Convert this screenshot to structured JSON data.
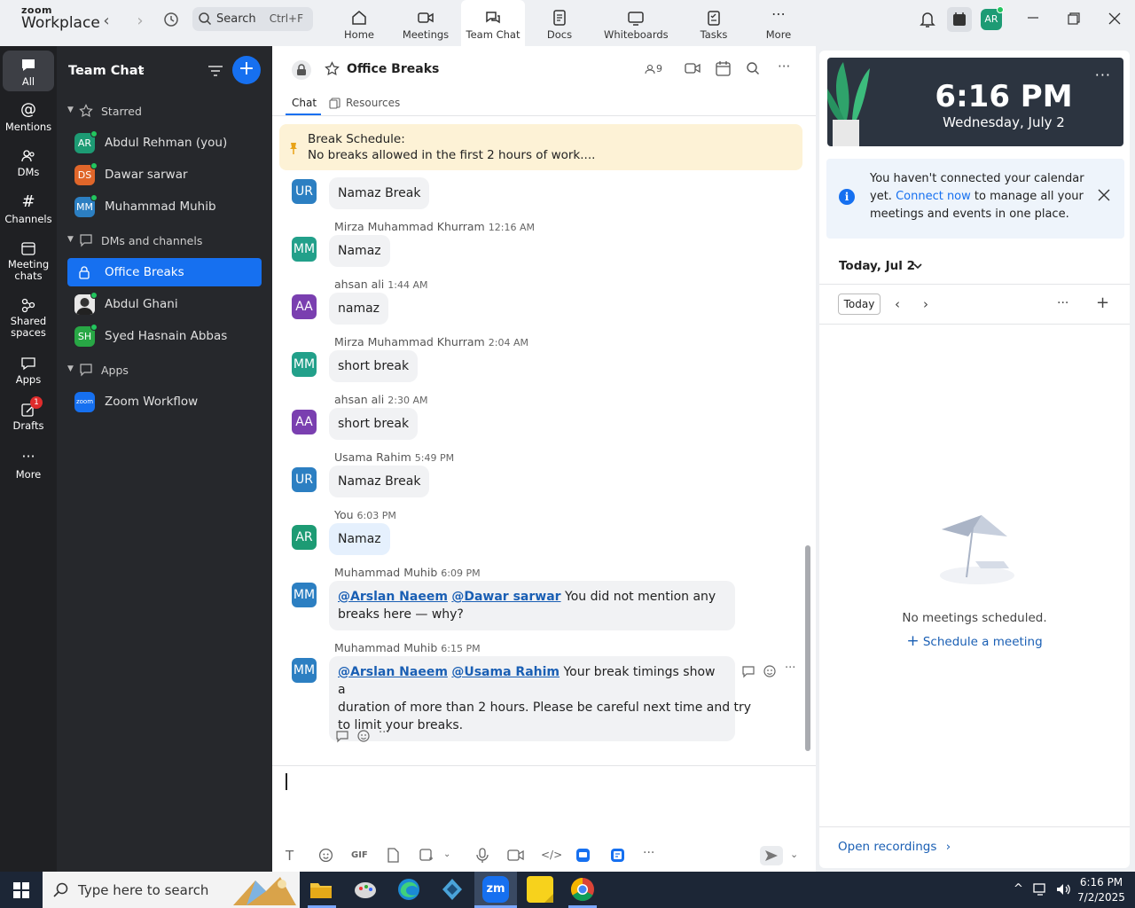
{
  "app": {
    "logo_small": "zoom",
    "logo_big": "Workplace",
    "search_label": "Search",
    "search_shortcut": "Ctrl+F",
    "nav": [
      {
        "label": "Home"
      },
      {
        "label": "Meetings"
      },
      {
        "label": "Team Chat"
      },
      {
        "label": "Docs"
      },
      {
        "label": "Whiteboards"
      },
      {
        "label": "Tasks"
      },
      {
        "label": "More"
      }
    ],
    "user_initials": "AR"
  },
  "rail": [
    {
      "label": "All"
    },
    {
      "label": "Mentions"
    },
    {
      "label": "DMs"
    },
    {
      "label": "Channels"
    },
    {
      "label": "Meeting chats"
    },
    {
      "label": "Shared spaces"
    },
    {
      "label": "Apps"
    },
    {
      "label": "Drafts"
    },
    {
      "label": "More"
    }
  ],
  "drafts_badge": "1",
  "sidebar": {
    "title": "Team Chat",
    "groups": {
      "starred": "Starred",
      "dms": "DMs and channels",
      "apps": "Apps"
    },
    "starred": [
      {
        "initials": "AR",
        "name": "Abdul Rehman (you)",
        "color": "#1d9b74"
      },
      {
        "initials": "DS",
        "name": "Dawar sarwar",
        "color": "#e0662a"
      },
      {
        "initials": "MM",
        "name": "Muhammad Muhib",
        "color": "#2c7fc2"
      }
    ],
    "dms": [
      {
        "name": "Office Breaks"
      },
      {
        "name": "Abdul Ghani"
      },
      {
        "initials": "SH",
        "name": "Syed Hasnain Abbas",
        "color": "#28a745"
      }
    ],
    "apps": [
      {
        "badge": "zoom",
        "name": "Zoom Workflow"
      }
    ]
  },
  "channel": {
    "title": "Office Breaks",
    "member_count": "9",
    "tabs": {
      "chat": "Chat",
      "resources": "Resources"
    },
    "pinned_title": "Break Schedule:",
    "pinned_text": "No breaks allowed in the first 2 hours of work...."
  },
  "messages": [
    {
      "initials": "UR",
      "color": "#2c7fc2",
      "text": "Namaz Break"
    },
    {
      "initials": "MM",
      "color": "#22a08a",
      "sender": "Mirza Muhammad Khurram",
      "time": "12:16 AM",
      "text": "Namaz"
    },
    {
      "initials": "AA",
      "color": "#7a3fb0",
      "sender": "ahsan ali",
      "time": "1:44 AM",
      "text": "namaz"
    },
    {
      "initials": "MM",
      "color": "#22a08a",
      "sender": "Mirza Muhammad Khurram",
      "time": "2:04 AM",
      "text": "short break"
    },
    {
      "initials": "AA",
      "color": "#7a3fb0",
      "sender": "ahsan ali",
      "time": "2:30 AM",
      "text": "short break"
    },
    {
      "initials": "UR",
      "color": "#2c7fc2",
      "sender": "Usama Rahim",
      "time": "5:49 PM",
      "text": "Namaz Break"
    },
    {
      "initials": "AR",
      "color": "#1d9b74",
      "sender": "You",
      "time": "6:03 PM",
      "text": "Namaz"
    },
    {
      "initials": "MM",
      "color": "#2c7fc2",
      "sender": "Muhammad Muhib",
      "time": "6:09 PM",
      "mention1": "@Arslan Naeem",
      "mention2": "@Dawar sarwar",
      "line1_rest": "You did not mention any",
      "line2": "breaks here — why?"
    },
    {
      "initials": "MM",
      "color": "#2c7fc2",
      "sender": "Muhammad Muhib",
      "time": "6:15 PM",
      "mention1": "@Arslan Naeem",
      "mention2": "@Usama Rahim",
      "line1_rest": "Your break timings show a",
      "line2": "duration of more than 2 hours. Please be careful next time and try",
      "line3": "to limit your breaks."
    }
  ],
  "compose": {
    "gif_label": "GIF"
  },
  "right": {
    "time": "6:16 PM",
    "date": "Wednesday, July 2",
    "notice_pre": "You haven't connected your calendar yet.",
    "notice_link": "Connect now",
    "notice_post": "to manage all your meetings and events in one place.",
    "cal_title": "Today, Jul 2",
    "today_btn": "Today",
    "empty": "No meetings scheduled.",
    "schedule": "Schedule a meeting",
    "open_recordings": "Open recordings"
  },
  "taskbar": {
    "search_placeholder": "Type here to search",
    "time": "6:16 PM",
    "date": "7/2/2025"
  },
  "colors": {
    "accent": "#1670f0",
    "rail_bg": "#1f2023",
    "sidebar_bg": "#26282c",
    "pinned_bg": "#fdf2d6"
  }
}
